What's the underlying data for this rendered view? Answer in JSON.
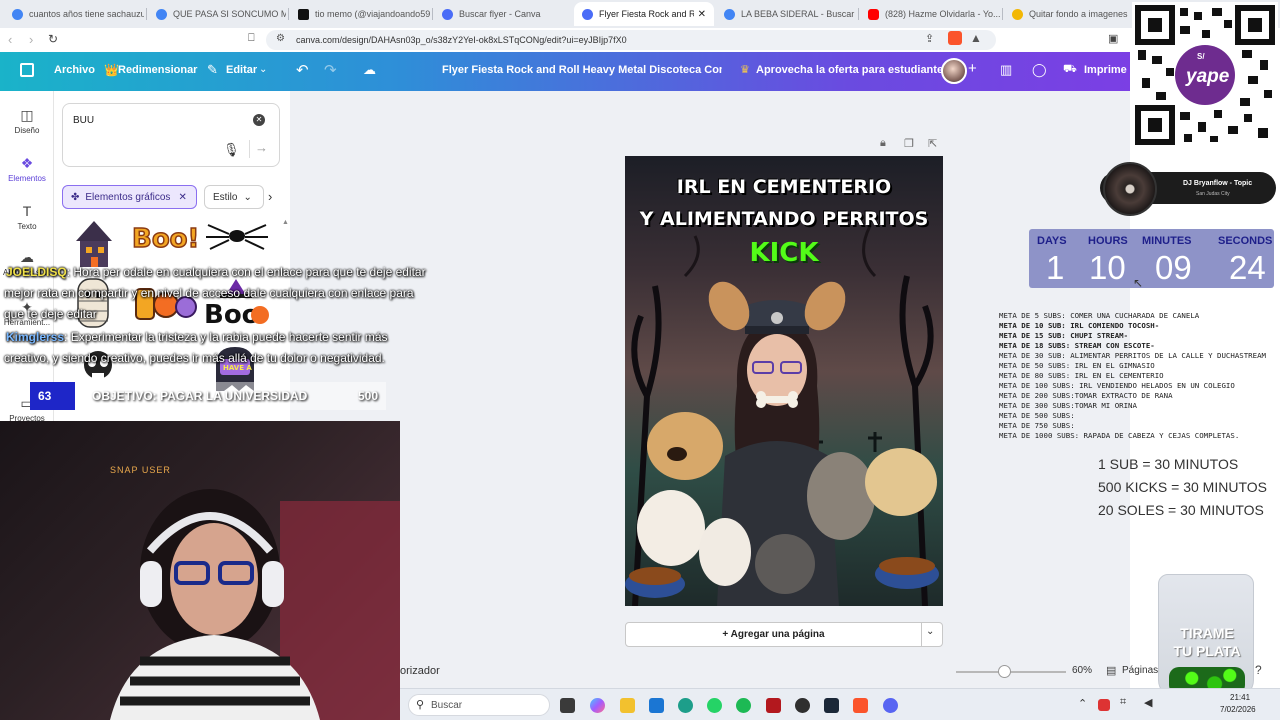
{
  "browser": {
    "tabs": [
      {
        "label": "cuantos años tiene sachauzum...",
        "color": "#4285f4"
      },
      {
        "label": "QUE PASA SI SONCUMO MUC...",
        "color": "#4285f4"
      },
      {
        "label": "tio memo (@viajandoando59...",
        "color": "#111111"
      },
      {
        "label": "Buscar flyer - Canva",
        "color": "#4a6cf7"
      },
      {
        "label": "Flyer Fiesta Rock and Roll H...",
        "color": "#4a6cf7",
        "active": true
      },
      {
        "label": "LA BEBA SIDERAL - Buscar con...",
        "color": "#4285f4"
      },
      {
        "label": "(828) Hazme Olvidarla - Yo...",
        "color": "#ff0000"
      },
      {
        "label": "Quitar fondo a imagenes onlin...",
        "color": "#f2b705"
      }
    ],
    "url": "canva.com/design/DAHAsn03p_o/s38zY2YeI-ok8xLSTqCONg/edit?ui=eyJBIjp7fX0"
  },
  "canva_header": {
    "file_label": "Archivo",
    "resize_label": "Redimensionar",
    "edit_label": "Editar",
    "doc_title": "Flyer Fiesta Rock and Roll Heavy Metal Discoteca Concierto...",
    "promo_label": "Aprovecha la oferta para estudiantes",
    "print_label": "Imprime c"
  },
  "rail": {
    "items": [
      {
        "label": "Diseño",
        "icon": "layout-icon"
      },
      {
        "label": "Elementos",
        "icon": "shapes-icon"
      },
      {
        "label": "Texto",
        "icon": "text-icon"
      },
      {
        "label": "Archivos su...",
        "icon": "upload-icon"
      },
      {
        "label": "Herramient...",
        "icon": "tools-icon"
      },
      {
        "label": "Proyectos",
        "icon": "folder-icon"
      }
    ]
  },
  "panel": {
    "search_value": "BUU",
    "chip_active": "Elementos gráficos",
    "chip_style": "Estilo",
    "results": [
      "haunted-house",
      "boo-text",
      "spider",
      "mummy",
      "boo-letters",
      "boo-witch-hat",
      "skull-sticker",
      "have-a-boo-ghost"
    ],
    "boo_text": "Boo!"
  },
  "flyer": {
    "line1": "IRL EN CEMENTERIO",
    "line2": "Y ALIMENTANDO PERRITOS",
    "line3": "KICK"
  },
  "canvas": {
    "add_page_label": "+ Agregar una página",
    "zoom": "60%",
    "pages_label": "Páginas",
    "notes_label": "orizador"
  },
  "chat": [
    {
      "user": "JOELDISQ",
      "text": ": Hora per odale en cualquiera con el enlace para que te deje editar",
      "color": "#f0e14a"
    },
    {
      "user": "",
      "text": "mejor rata en compartir y en nivel de acceso dale cualquiera con enlace para",
      "color": ""
    },
    {
      "user": "",
      "text": "que te deje editar",
      "color": ""
    },
    {
      "user": "Kimglerss",
      "text": ": Experimentar la tristeza y la rabia puede hacerte sentir más",
      "color": "#7ab8ff"
    },
    {
      "user": "",
      "text": "creativo, y siendo creativo, puedes ir más allá de tu dolor o negatividad.",
      "color": ""
    }
  ],
  "goal": {
    "current": "63",
    "label": "OBJETIVO: PAGAR LA UNIVERSIDAD",
    "target": "500",
    "progress": 0.126
  },
  "webcam": {
    "sign": "SNAP USER"
  },
  "now_playing": {
    "title": "DJ Bryanflow - Topic",
    "subtitle": "San Judas City"
  },
  "countdown": {
    "labels": [
      "DAYS",
      "HOURS",
      "MINUTES",
      "SECONDS"
    ],
    "values": [
      "1",
      "10",
      "09",
      "24"
    ]
  },
  "metas": [
    {
      "text": "META DE 5 SUBS: COMER UNA CUCHARADA DE CANELA",
      "done": false
    },
    {
      "text": "META DE 10 SUB: IRL COMIENDO TOCOSH-",
      "done": true
    },
    {
      "text": "META DE 15 SUB: CHUPI STREAM-",
      "done": true
    },
    {
      "text": "META DE 18 SUBS: STREAM CON ESCOTE-",
      "done": true
    },
    {
      "text": "META DE 30 SUB:  ALIMENTAR PERRITOS DE LA CALLE Y DUCHASTREAM",
      "done": false
    },
    {
      "text": "META DE 50 SUBS: IRL EN EL GIMNASIO",
      "done": false
    },
    {
      "text": "META DE 80 SUBS: IRL EN EL CEMENTERIO",
      "done": false
    },
    {
      "text": "META DE 100 SUBS: IRL VENDIENDO HELADOS EN UN COLEGIO",
      "done": false
    },
    {
      "text": "META DE 200 SUBS:TOMAR EXTRACTO DE RANA",
      "done": false
    },
    {
      "text": "META DE 300 SUBS:TOMAR MI ORINA",
      "done": false
    },
    {
      "text": "META DE 500 SUBS:",
      "done": false
    },
    {
      "text": "META DE 750 SUBS:",
      "done": false
    },
    {
      "text": "META DE 1000 SUBS: RAPADA DE CABEZA Y CEJAS COMPLETAS.",
      "done": false
    }
  ],
  "rates": [
    "1 SUB = 30 MINUTOS",
    "500 KICKS = 30 MINUTOS",
    "20 SOLES = 30 MINUTOS"
  ],
  "tip_jar": {
    "line1": "TIRAME",
    "line2": "TU PLATA"
  },
  "qr": {
    "brand": "yape",
    "currency": "S/"
  },
  "taskbar": {
    "search_placeholder": "Buscar",
    "time": "21:41",
    "date": "7/02/2026"
  },
  "colors": {
    "goal_blue": "#1e26c8",
    "countdown_bg": "#8e93c8",
    "flyer_title": "#ffffff",
    "flyer_kick": "#53fc18"
  }
}
